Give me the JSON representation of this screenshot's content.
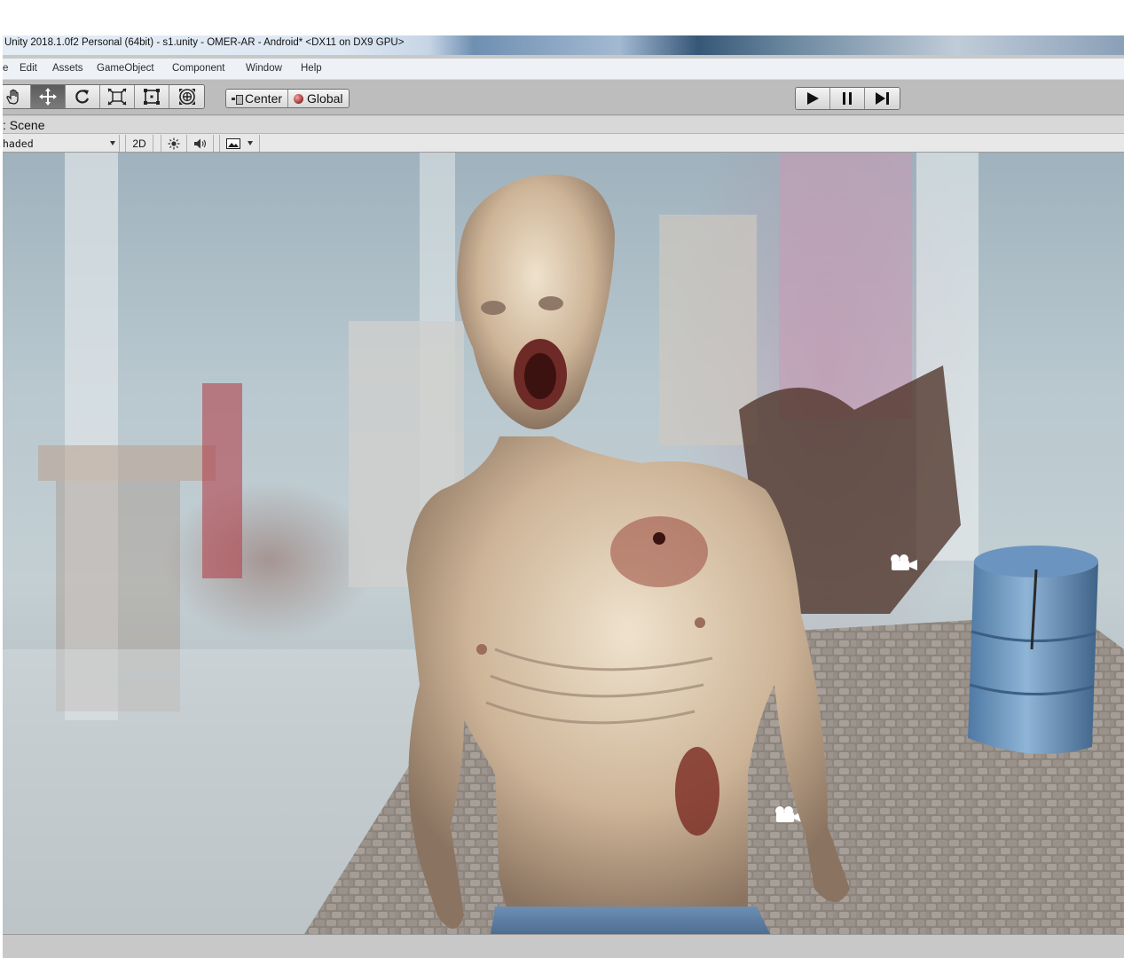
{
  "window": {
    "title": "Unity 2018.1.0f2 Personal (64bit) - s1.unity - OMER-AR - Android* <DX11 on DX9 GPU>"
  },
  "menu": {
    "items": [
      "e",
      "Edit",
      "Assets",
      "GameObject",
      "Component",
      "Window",
      "Help"
    ]
  },
  "toolbar": {
    "tools": [
      "hand-icon",
      "move-icon",
      "rotate-icon",
      "scale-icon",
      "rect-icon",
      "transform-icon"
    ],
    "active_tool": "move-icon",
    "pivot_mode": "Center",
    "pivot_rotation": "Global",
    "playback": [
      "play-icon",
      "pause-icon",
      "step-icon"
    ]
  },
  "scene": {
    "tab_label": ": Scene",
    "draw_mode": "haded",
    "mode_2d": "2D",
    "toggles": [
      "lighting-icon",
      "audio-icon",
      "effects-icon"
    ]
  },
  "colors": {
    "toolbar": "#bdbdbd",
    "active_tool": "#5b5b5b",
    "barrel": "#5d8bb8",
    "floor": "#8f8780",
    "skin": "#d6c1a4"
  }
}
